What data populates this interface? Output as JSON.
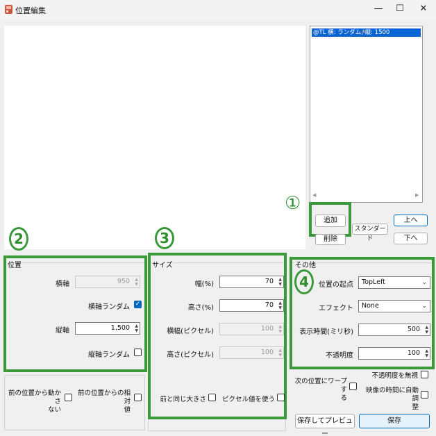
{
  "window": {
    "title": "位置編集",
    "minimize_glyph": "—",
    "maximize_glyph": "☐",
    "close_glyph": "✕"
  },
  "list": {
    "items": [
      "@TL 横: ランダム, 縦: 1500"
    ],
    "selected_index": 0
  },
  "buttons": {
    "add": "追加",
    "delete": "削除",
    "standard": "スタンダード",
    "up": "上へ",
    "down": "下へ",
    "save_preview": "保存してプレビュー",
    "save": "保存"
  },
  "annotations": {
    "one": "①",
    "two": "2",
    "three": "3",
    "four": "4"
  },
  "position": {
    "legend": "位置",
    "horizontal_label": "横軸",
    "horizontal_value": "950",
    "horizontal_random_label": "横軸ランダム",
    "horizontal_random_checked": true,
    "vertical_label": "縦軸",
    "vertical_value": "1,500",
    "vertical_random_label": "縦軸ランダム",
    "vertical_random_checked": false,
    "no_move_label_1": "前の位置から動かさ",
    "no_move_label_2": "ない",
    "relative_label_1": "前の位置からの相対",
    "relative_label_2": "値"
  },
  "size": {
    "legend": "サイズ",
    "width_pct_label": "幅(%)",
    "width_pct_value": "70",
    "height_pct_label": "高さ(%)",
    "height_pct_value": "70",
    "width_px_label": "横幅(ピクセル)",
    "width_px_value": "100",
    "height_px_label": "高さ(ピクセル)",
    "height_px_value": "100",
    "same_size_label": "前と同じ大きさ",
    "use_pixels_label": "ピクセル値を使う"
  },
  "other": {
    "legend": "その他",
    "origin_label": "位置の起点",
    "origin_value": "TopLeft",
    "effect_label": "エフェクト",
    "effect_value": "None",
    "duration_label": "表示時間(ミリ秒)",
    "duration_value": "500",
    "opacity_label": "不透明度",
    "opacity_value": "100",
    "ignore_opacity_label": "不透明度を無視",
    "warp_label_1": "次の位置にワープす",
    "warp_label_2": "る",
    "auto_adjust_label_1": "映像の時間に自動調",
    "auto_adjust_label_2": "整"
  }
}
